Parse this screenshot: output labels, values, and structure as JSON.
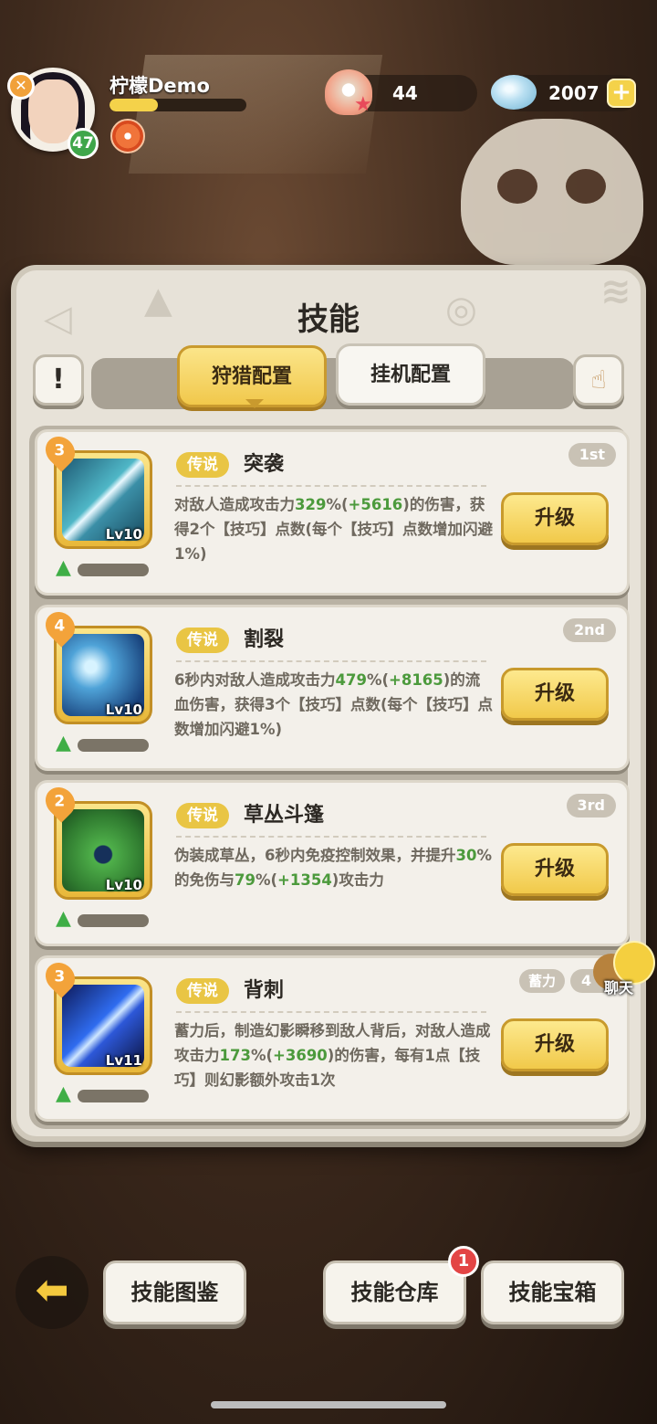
{
  "player": {
    "name": "柠檬Demo",
    "level": "47",
    "exp_fraction": 0.35
  },
  "resources": {
    "pearls": "44",
    "gems": "2007"
  },
  "panel": {
    "title": "技能",
    "tabs": [
      {
        "label": "狩猎配置",
        "active": true
      },
      {
        "label": "挂机配置",
        "active": false
      }
    ]
  },
  "skills": [
    {
      "stars": "3",
      "level": "Lv10",
      "rarity": "传说",
      "name": "突袭",
      "rank": "1st",
      "desc_parts": [
        "对敌人造成攻击力",
        "329",
        "%(",
        "+5616",
        ")的伤害，获得2个【技巧】点数(每个【技巧】点数增加闪避1%)"
      ],
      "button": "升级"
    },
    {
      "stars": "4",
      "level": "Lv10",
      "rarity": "传说",
      "name": "割裂",
      "rank": "2nd",
      "desc_parts": [
        "6秒内对敌人造成攻击力",
        "479",
        "%(",
        "+8165",
        ")的流血伤害，获得3个【技巧】点数(每个【技巧】点数增加闪避1%)"
      ],
      "button": "升级"
    },
    {
      "stars": "2",
      "level": "Lv10",
      "rarity": "传说",
      "name": "草丛斗篷",
      "rank": "3rd",
      "desc_parts": [
        "伪装成草丛，6秒内免疫控制效果，并提升",
        "30",
        "%的免伤与",
        "79",
        "%(",
        "+1354",
        ")攻击力"
      ],
      "button": "升级"
    },
    {
      "stars": "3",
      "level": "Lv11",
      "rarity": "传说",
      "name": "背刺",
      "rank": "4",
      "tag": "蓄力",
      "desc_parts": [
        "蓄力后，制造幻影瞬移到敌人背后，对敌人造成攻击力",
        "173",
        "%(",
        "+3690",
        ")的伤害，每有1点【技巧】则幻影额外攻击1次"
      ],
      "button": "升级"
    }
  ],
  "chat_label": "聊天",
  "bottom": {
    "atlas": "技能图鉴",
    "store": "技能仓库",
    "store_badge": "1",
    "chest": "技能宝箱"
  }
}
